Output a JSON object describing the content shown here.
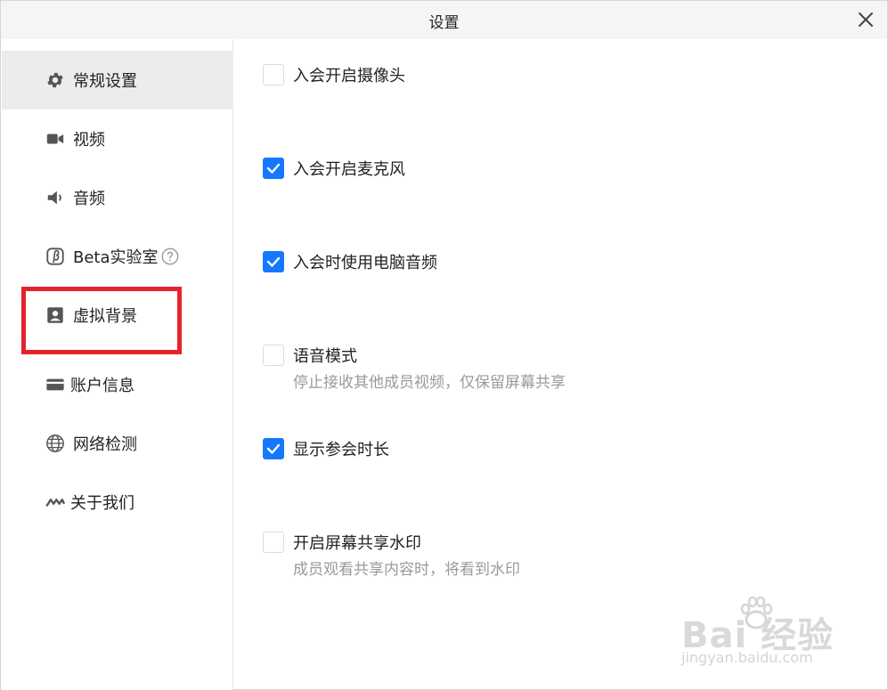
{
  "window": {
    "title": "设置"
  },
  "sidebar": {
    "items": [
      {
        "label": "常规设置",
        "icon": "gear-icon",
        "active": true
      },
      {
        "label": "视频",
        "icon": "video-camera-icon"
      },
      {
        "label": "音频",
        "icon": "speaker-icon"
      },
      {
        "label": "Beta实验室",
        "icon": "beta-icon",
        "extra_icon": "help-circle-icon"
      },
      {
        "label": "虚拟背景",
        "icon": "person-portrait-icon",
        "highlighted": true
      },
      {
        "label": "账户信息",
        "icon": "card-icon"
      },
      {
        "label": "网络检测",
        "icon": "globe-icon"
      },
      {
        "label": "关于我们",
        "icon": "logo-wave-icon"
      }
    ]
  },
  "options": [
    {
      "label": "入会开启摄像头",
      "checked": false
    },
    {
      "label": "入会开启麦克风",
      "checked": true
    },
    {
      "label": "入会时使用电脑音频",
      "checked": true
    },
    {
      "label": "语音模式",
      "desc": "停止接收其他成员视频，仅保留屏幕共享",
      "checked": false
    },
    {
      "label": "显示参会时长",
      "checked": true
    },
    {
      "label": "开启屏幕共享水印",
      "desc": "成员观看共享内容时，将看到水印",
      "checked": false
    }
  ],
  "colors": {
    "accent": "#1677ff",
    "highlight": "#e5232c",
    "active_bg": "#ececec"
  },
  "watermark": {
    "brand": "Bai 经验",
    "url": "jingyan.baidu.com"
  }
}
